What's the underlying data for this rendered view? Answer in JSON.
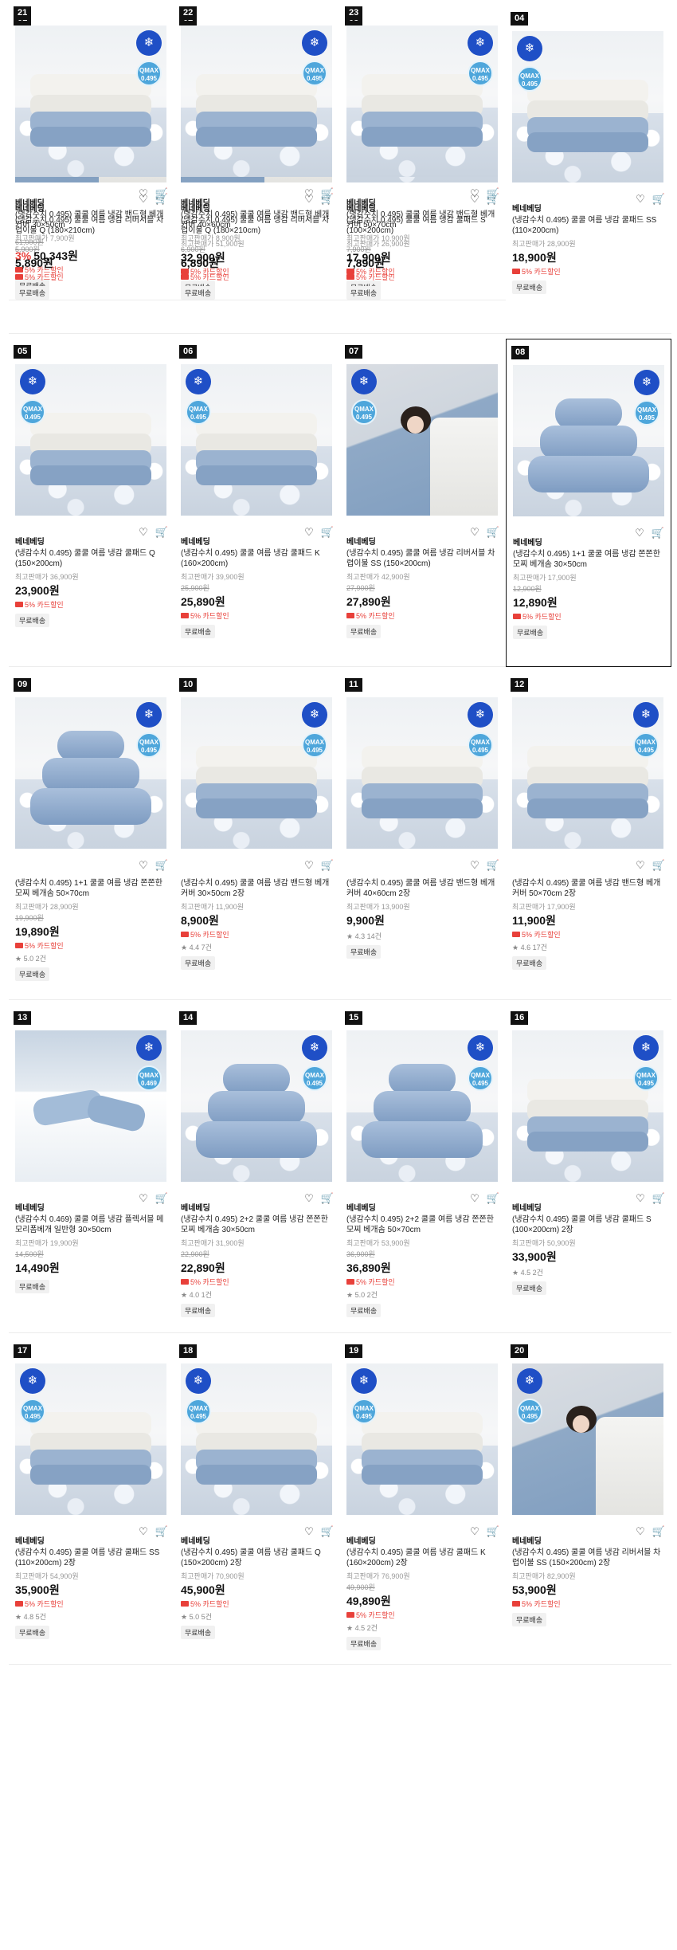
{
  "shipping_label": "무료배송",
  "card_discount": "5% 카드할인",
  "max_price_prefix": "최고판매가",
  "badge_qmax": "QMAX",
  "products": [
    {
      "rank": "01",
      "brand": "베네베딩",
      "name": "(냉감수치 0.495) 쿨쿨 여름 냉감 리버서블 차렵이불 Q (180×210cm)",
      "max_price": "",
      "orig": "61,000원",
      "discount": "3%",
      "price": "50,343원",
      "card": true,
      "rating": "",
      "reviews": "",
      "qmax": "0.495",
      "img": "bed"
    },
    {
      "rank": "02",
      "brand": "베네베딩",
      "name": "(냉감수치 0.495) 쿨쿨 여름 냉감 리버서블 차렵이불 Q (180×210cm)",
      "max_price": "51,900원",
      "orig": "",
      "discount": "",
      "price": "32,900원",
      "card": true,
      "rating": "",
      "reviews": "",
      "qmax": "0.495",
      "img": "bed"
    },
    {
      "rank": "03",
      "brand": "베네베딩",
      "name": "(냉감수치 0.495) 쿨쿨 여름 냉감 쿨패드 S (100×200cm)",
      "max_price": "26,900원",
      "orig": "",
      "discount": "",
      "price": "17,900원",
      "card": true,
      "rating": "",
      "reviews": "",
      "qmax": "0.495",
      "img": "fold"
    },
    {
      "rank": "04",
      "brand": "베네베딩",
      "name": "(냉감수치 0.495) 쿨쿨 여름 냉감 쿨패드 SS (110×200cm)",
      "max_price": "28,900원",
      "orig": "",
      "discount": "",
      "price": "18,900원",
      "card": true,
      "rating": "",
      "reviews": "",
      "qmax": "0.495",
      "img": "fold"
    },
    {
      "rank": "05",
      "brand": "베네베딩",
      "name": "(냉감수치 0.495) 쿨쿨 여름 냉감 쿨패드 Q (150×200cm)",
      "max_price": "36,900원",
      "orig": "",
      "discount": "",
      "price": "23,900원",
      "card": true,
      "rating": "",
      "reviews": "",
      "qmax": "0.495",
      "img": "fold"
    },
    {
      "rank": "06",
      "brand": "베네베딩",
      "name": "(냉감수치 0.495) 쿨쿨 여름 냉감 쿨패드 K (160×200cm)",
      "max_price": "39,900원",
      "orig": "25,900원",
      "discount": "",
      "price": "25,890원",
      "card": true,
      "rating": "",
      "reviews": "",
      "qmax": "0.495",
      "img": "fold"
    },
    {
      "rank": "07",
      "brand": "베네베딩",
      "name": "(냉감수치 0.495) 쿨쿨 여름 냉감 리버서블 차렵이불 SS (150×200cm)",
      "max_price": "42,900원",
      "orig": "27,900원",
      "discount": "",
      "price": "27,890원",
      "card": true,
      "rating": "",
      "reviews": "",
      "qmax": "0.495",
      "img": "bed"
    },
    {
      "rank": "08",
      "brand": "베네베딩",
      "name": "(냉감수치 0.495) 1+1 쿨쿨 여름 냉감 쫀쫀한 모찌 베개솜 30×50cm",
      "max_price": "17,900원",
      "orig": "12,900원",
      "discount": "",
      "price": "12,890원",
      "card": true,
      "rating": "",
      "reviews": "",
      "qmax": "0.495",
      "img": "pillow",
      "selected": true
    },
    {
      "rank": "09",
      "brand": "",
      "name": "(냉감수치 0.495) 1+1 쿨쿨 여름 냉감 쫀쫀한 모찌 베개솜 50×70cm",
      "max_price": "28,900원",
      "orig": "19,900원",
      "discount": "",
      "price": "19,890원",
      "card": true,
      "rating": "5.0",
      "reviews": "2건",
      "qmax": "0.495",
      "img": "pillow"
    },
    {
      "rank": "10",
      "brand": "",
      "name": "(냉감수치 0.495) 쿨쿨 여름 냉감 밴드형 베개커버 30×50cm 2장",
      "max_price": "11,900원",
      "orig": "",
      "discount": "",
      "price": "8,900원",
      "card": true,
      "rating": "4.4",
      "reviews": "7건",
      "qmax": "0.495",
      "img": "fold"
    },
    {
      "rank": "11",
      "brand": "",
      "name": "(냉감수치 0.495) 쿨쿨 여름 냉감 밴드형 베개커버 40×60cm 2장",
      "max_price": "13,900원",
      "orig": "",
      "discount": "",
      "price": "9,900원",
      "card": false,
      "rating": "4.3",
      "reviews": "14건",
      "qmax": "0.495",
      "img": "fold"
    },
    {
      "rank": "12",
      "brand": "",
      "name": "(냉감수치 0.495) 쿨쿨 여름 냉감 밴드형 베개커버 50×70cm 2장",
      "max_price": "17,900원",
      "orig": "",
      "discount": "",
      "price": "11,900원",
      "card": true,
      "rating": "4.6",
      "reviews": "17건",
      "qmax": "0.495",
      "img": "fold"
    },
    {
      "rank": "13",
      "brand": "베네베딩",
      "name": "(냉감수치 0.469) 쿨쿨 여름 냉감 플렉서블 메모리폼베개 일반형 30×50cm",
      "max_price": "19,900원",
      "orig": "14,500원",
      "discount": "",
      "price": "14,490원",
      "card": false,
      "rating": "",
      "reviews": "",
      "qmax": "0.469",
      "img": "memory"
    },
    {
      "rank": "14",
      "brand": "베네베딩",
      "name": "(냉감수치 0.495) 2+2 쿨쿨 여름 냉감 쫀쫀한 모찌 베개솜 30×50cm",
      "max_price": "31,900원",
      "orig": "22,900원",
      "discount": "",
      "price": "22,890원",
      "card": true,
      "rating": "4.0",
      "reviews": "1건",
      "qmax": "0.495",
      "img": "pillow"
    },
    {
      "rank": "15",
      "brand": "베네베딩",
      "name": "(냉감수치 0.495) 2+2 쿨쿨 여름 냉감 쫀쫀한 모찌 베개솜 50×70cm",
      "max_price": "53,900원",
      "orig": "36,900원",
      "discount": "",
      "price": "36,890원",
      "card": true,
      "rating": "5.0",
      "reviews": "2건",
      "qmax": "0.495",
      "img": "pillow"
    },
    {
      "rank": "16",
      "brand": "베네베딩",
      "name": "(냉감수치 0.495) 쿨쿨 여름 냉감 쿨패드 S (100×200cm) 2장",
      "max_price": "50,900원",
      "orig": "",
      "discount": "",
      "price": "33,900원",
      "card": false,
      "rating": "4.5",
      "reviews": "2건",
      "qmax": "0.495",
      "img": "fold"
    },
    {
      "rank": "17",
      "brand": "베네베딩",
      "name": "(냉감수치 0.495) 쿨쿨 여름 냉감 쿨패드 SS (110×200cm) 2장",
      "max_price": "54,900원",
      "orig": "",
      "discount": "",
      "price": "35,900원",
      "card": true,
      "rating": "4.8",
      "reviews": "5건",
      "qmax": "0.495",
      "img": "fold"
    },
    {
      "rank": "18",
      "brand": "베네베딩",
      "name": "(냉감수치 0.495) 쿨쿨 여름 냉감 쿨패드 Q (150×200cm) 2장",
      "max_price": "70,900원",
      "orig": "",
      "discount": "",
      "price": "45,900원",
      "card": true,
      "rating": "5.0",
      "reviews": "5건",
      "qmax": "0.495",
      "img": "fold"
    },
    {
      "rank": "19",
      "brand": "베네베딩",
      "name": "(냉감수치 0.495) 쿨쿨 여름 냉감 쿨패드 K (160×200cm) 2장",
      "max_price": "76,900원",
      "orig": "49,900원",
      "discount": "",
      "price": "49,890원",
      "card": true,
      "rating": "4.5",
      "reviews": "2건",
      "qmax": "0.495",
      "img": "fold"
    },
    {
      "rank": "20",
      "brand": "베네베딩",
      "name": "(냉감수치 0.495) 쿨쿨 여름 냉감 리버서블 차렵이불 SS (150×200cm) 2장",
      "max_price": "82,900원",
      "orig": "",
      "discount": "",
      "price": "53,900원",
      "card": true,
      "rating": "",
      "reviews": "",
      "qmax": "0.495",
      "img": "bed"
    },
    {
      "rank": "21",
      "brand": "베네베딩",
      "name": "(냉감수치 0.495) 쿨쿨 여름 냉감 밴드형 베개커버 30×50cm",
      "max_price": "7,900원",
      "orig": "5,900원",
      "discount": "",
      "price": "5,890원",
      "card": true,
      "rating": "",
      "reviews": "",
      "qmax": "0.495",
      "img": "fold"
    },
    {
      "rank": "22",
      "brand": "베네베딩",
      "name": "(냉감수치 0.495) 쿨쿨 여름 냉감 밴드형 베개커버 40×60cm",
      "max_price": "8,900원",
      "orig": "6,900원",
      "discount": "",
      "price": "6,890원",
      "card": true,
      "rating": "",
      "reviews": "",
      "qmax": "0.495",
      "img": "fold"
    },
    {
      "rank": "23",
      "brand": "베네베딩",
      "name": "(냉감수치 0.495) 쿨쿨 여름 냉감 밴드형 베개커버 50×70cm",
      "max_price": "10,900원",
      "orig": "7,900원",
      "discount": "",
      "price": "7,890원",
      "card": true,
      "rating": "",
      "reviews": "",
      "qmax": "0.495",
      "img": "fold"
    }
  ]
}
